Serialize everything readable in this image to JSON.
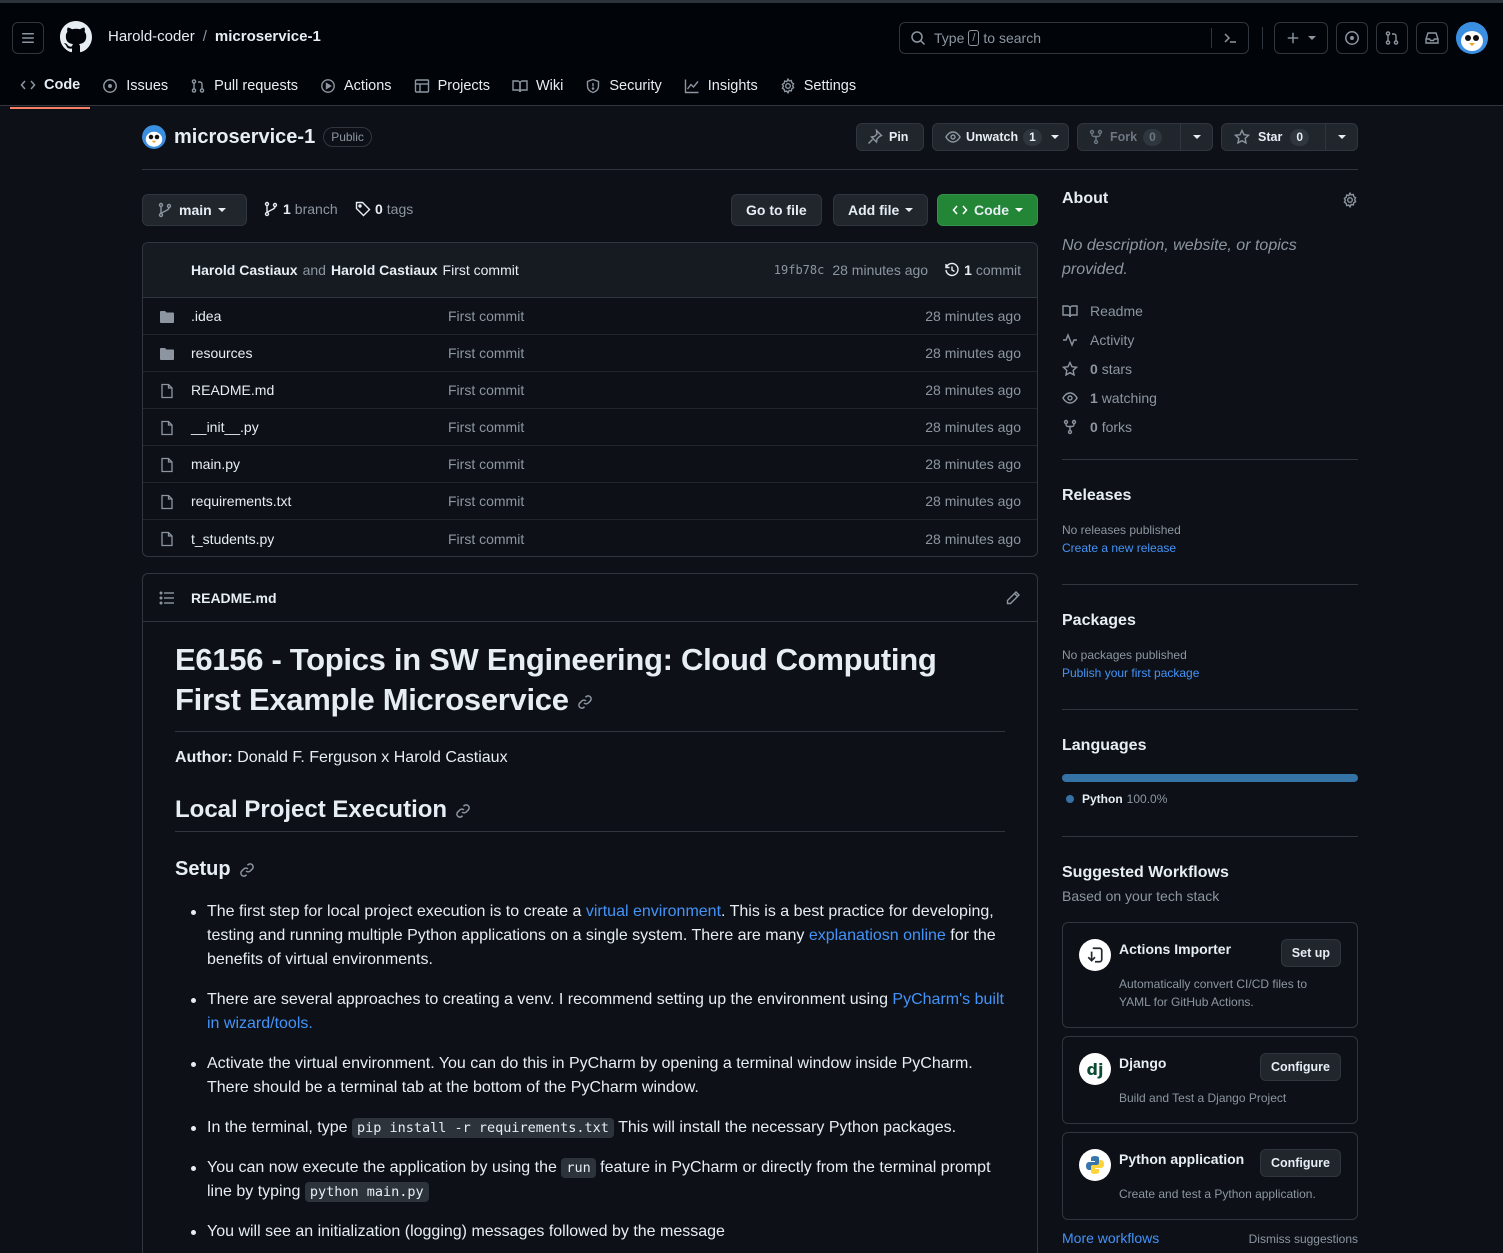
{
  "header": {
    "owner": "Harold-coder",
    "separator": "/",
    "repo": "microservice-1",
    "search_prefix": "Type",
    "search_key": "/",
    "search_suffix": "to search"
  },
  "tabs": [
    {
      "label": "Code"
    },
    {
      "label": "Issues"
    },
    {
      "label": "Pull requests"
    },
    {
      "label": "Actions"
    },
    {
      "label": "Projects"
    },
    {
      "label": "Wiki"
    },
    {
      "label": "Security"
    },
    {
      "label": "Insights"
    },
    {
      "label": "Settings"
    }
  ],
  "repo": {
    "name": "microservice-1",
    "visibility": "Public",
    "pin": "Pin",
    "unwatch": "Unwatch",
    "unwatch_count": "1",
    "fork": "Fork",
    "fork_count": "0",
    "star": "Star",
    "star_count": "0"
  },
  "toolbar": {
    "branch": "main",
    "branch_count": "1",
    "branch_label": "branch",
    "tag_count": "0",
    "tag_label": "tags",
    "go_to_file": "Go to file",
    "add_file": "Add file",
    "code": "Code"
  },
  "commit": {
    "author1": "Harold Castiaux",
    "and": "and",
    "author2": "Harold Castiaux",
    "message": "First commit",
    "sha": "19fb78c",
    "ago": "28 minutes ago",
    "count": "1",
    "count_label": "commit"
  },
  "files": [
    {
      "name": ".idea",
      "type": "folder",
      "message": "First commit",
      "time": "28 minutes ago"
    },
    {
      "name": "resources",
      "type": "folder",
      "message": "First commit",
      "time": "28 minutes ago"
    },
    {
      "name": "README.md",
      "type": "file",
      "message": "First commit",
      "time": "28 minutes ago"
    },
    {
      "name": "__init__.py",
      "type": "file",
      "message": "First commit",
      "time": "28 minutes ago"
    },
    {
      "name": "main.py",
      "type": "file",
      "message": "First commit",
      "time": "28 minutes ago"
    },
    {
      "name": "requirements.txt",
      "type": "file",
      "message": "First commit",
      "time": "28 minutes ago"
    },
    {
      "name": "t_students.py",
      "type": "file",
      "message": "First commit",
      "time": "28 minutes ago"
    }
  ],
  "readme": {
    "filename": "README.md",
    "h1": "E6156 - Topics in SW Engineering: Cloud Computing First Example Microservice",
    "author_label": "Author:",
    "author_value": "Donald F. Ferguson x Harold Castiaux",
    "h2": "Local Project Execution",
    "h3": "Setup",
    "b1_pre": "The first step for local project execution is to create a ",
    "b1_link1": "virtual environment",
    "b1_mid": ". This is a best practice for developing, testing and running multiple Python applications on a single system. There are many ",
    "b1_link2": "explanatiosn online",
    "b1_post": " for the benefits of virtual environments.",
    "b2_pre": "There are several approaches to creating a venv. I recommend setting up the environment using ",
    "b2_link": "PyCharm's built in wizard/tools.",
    "b3": "Activate the virtual environment. You can do this in PyCharm by opening a terminal window inside PyCharm. There should be a terminal tab at the bottom of the PyCharm window.",
    "b4_pre": "In the terminal, type ",
    "b4_code": "pip install -r requirements.txt",
    "b4_post": " This will install the necessary Python packages.",
    "b5_pre": "You can now execute the application by using the ",
    "b5_code1": "run",
    "b5_mid": " feature in PyCharm or directly from the terminal prompt line by typing ",
    "b5_code2": "python main.py",
    "b6": "You will see an initialization (logging) messages followed by the message"
  },
  "about": {
    "title": "About",
    "description": "No description, website, or topics provided.",
    "items": [
      {
        "icon": "book-icon",
        "label": "Readme"
      },
      {
        "icon": "pulse-icon",
        "label": "Activity"
      },
      {
        "icon": "star-icon",
        "count": "0",
        "label": "stars"
      },
      {
        "icon": "eye-icon",
        "count": "1",
        "label": "watching"
      },
      {
        "icon": "fork-icon",
        "count": "0",
        "label": "forks"
      }
    ]
  },
  "releases": {
    "title": "Releases",
    "none": "No releases published",
    "link": "Create a new release"
  },
  "packages": {
    "title": "Packages",
    "none": "No packages published",
    "link": "Publish your first package"
  },
  "languages": {
    "title": "Languages",
    "name": "Python",
    "percent": "100.0%",
    "fraction": 1.0,
    "color": "#3572a5"
  },
  "workflows": {
    "title": "Suggested Workflows",
    "subtitle": "Based on your tech stack",
    "items": [
      {
        "name": "Actions Importer",
        "button": "Set up",
        "desc": "Automatically convert CI/CD files to YAML for GitHub Actions."
      },
      {
        "name": "Django",
        "button": "Configure",
        "desc": "Build and Test a Django Project"
      },
      {
        "name": "Python application",
        "button": "Configure",
        "desc": "Create and test a Python application."
      }
    ],
    "more": "More workflows",
    "dismiss": "Dismiss suggestions"
  },
  "colors": {
    "accent": "#f78166",
    "link": "#4493f8",
    "green": "#238636",
    "background": "#0d1117"
  }
}
